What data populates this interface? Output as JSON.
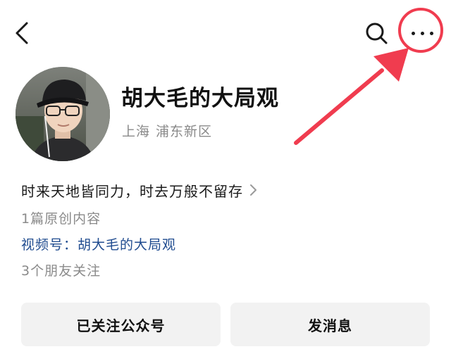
{
  "header": {
    "back_icon": "chevron-left-icon",
    "search_icon": "search-icon",
    "more_icon": "more-horizontal-icon"
  },
  "profile": {
    "name": "胡大毛的大局观",
    "location_province": "上海",
    "location_district": "浦东新区",
    "bio": "时来天地皆同力，时去万般不留存",
    "original_count": "1篇原创内容",
    "video_channel": "视频号：胡大毛的大局观",
    "friends_follow": "3个朋友关注"
  },
  "actions": {
    "followed_label": "已关注公众号",
    "message_label": "发消息"
  },
  "colors": {
    "annotation": "#f03c4f",
    "link": "#1f4b8f",
    "secondary_text": "#8a8a8a",
    "button_bg": "#f2f2f2"
  }
}
